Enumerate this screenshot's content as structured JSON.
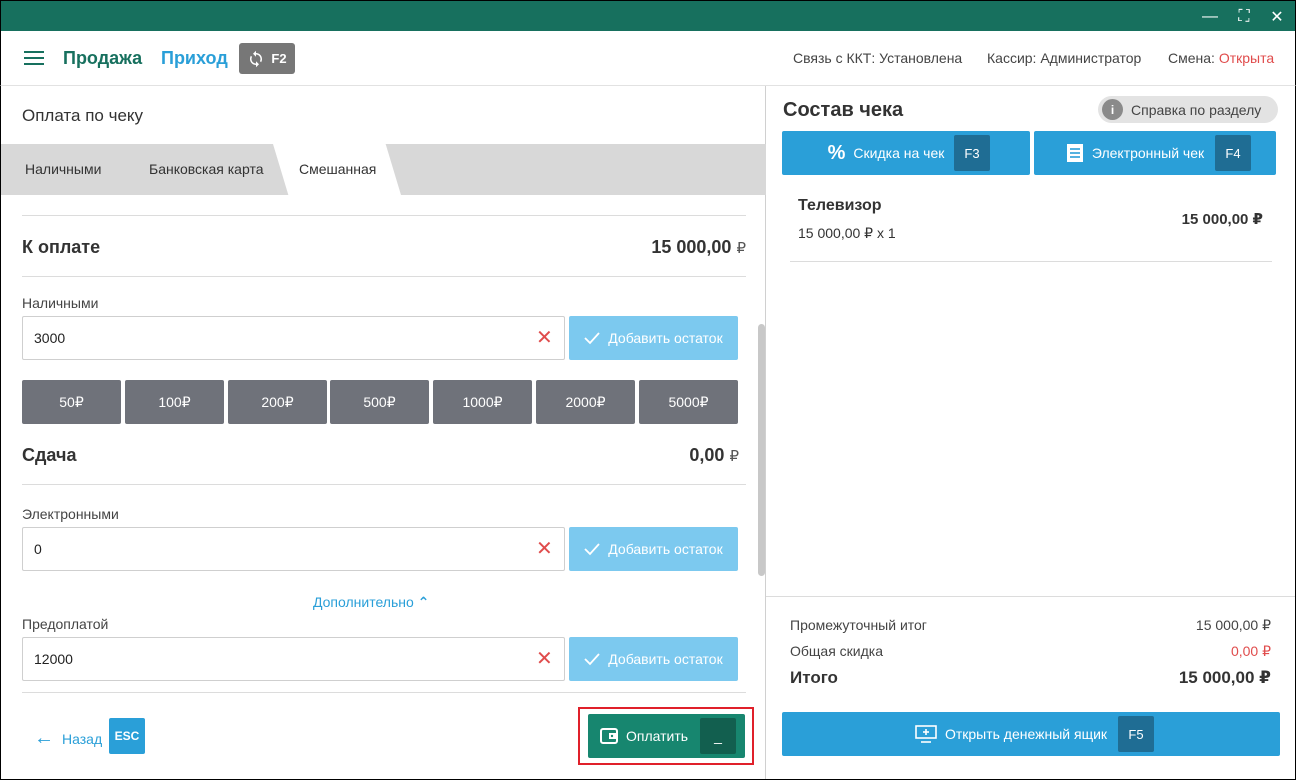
{
  "window": {
    "minimize_glyph": "—",
    "maximize_glyph": "⛶",
    "close_glyph": "✕"
  },
  "header": {
    "nav_sale": "Продажа",
    "nav_income": "Приход",
    "refresh_key": "F2",
    "kkt_status": "Связь с ККТ: Установлена",
    "cashier": "Кассир: Администратор",
    "shift_label": "Смена: ",
    "shift_value": "Открыта"
  },
  "payment": {
    "title": "Оплата по чеку",
    "tabs": [
      {
        "label": "Наличными"
      },
      {
        "label": "Банковская карта"
      },
      {
        "label": "Смешанная"
      }
    ],
    "to_pay_label": "К оплате",
    "to_pay_value": "15 000,00",
    "currency": "₽",
    "cash_label": "Наличными",
    "cash_value": "3000",
    "add_rest_label": "Добавить остаток",
    "denominations": [
      "50₽",
      "100₽",
      "200₽",
      "500₽",
      "1000₽",
      "2000₽",
      "5000₽"
    ],
    "change_label": "Сдача",
    "change_value": "0,00",
    "electronic_label": "Электронными",
    "electronic_value": "0",
    "more_label": "Дополнительно",
    "prepay_label": "Предоплатой",
    "prepay_value": "12000",
    "back_label": "Назад",
    "back_key": "ESC",
    "pay_label": "Оплатить",
    "pay_key": "_"
  },
  "receipt": {
    "title": "Состав чека",
    "help_label": "Справка по разделу",
    "discount_label": "Скидка на чек",
    "discount_key": "F3",
    "eticket_label": "Электронный чек",
    "eticket_key": "F4",
    "items": [
      {
        "name": "Телевизор",
        "detail": "15 000,00 ₽ x 1",
        "price": "15 000,00 ₽"
      }
    ],
    "subtotal_label": "Промежуточный итог",
    "subtotal_value": "15 000,00 ₽",
    "discount_total_label": "Общая скидка",
    "discount_total_value": "0,00 ₽",
    "total_label": "Итого",
    "total_value": "15 000,00 ₽",
    "drawer_label": "Открыть денежный ящик",
    "drawer_key": "F5"
  },
  "colors": {
    "brand_green": "#17705e",
    "accent_blue": "#2a9fd8",
    "light_blue": "#7cc9ef",
    "red": "#e04c4c"
  }
}
